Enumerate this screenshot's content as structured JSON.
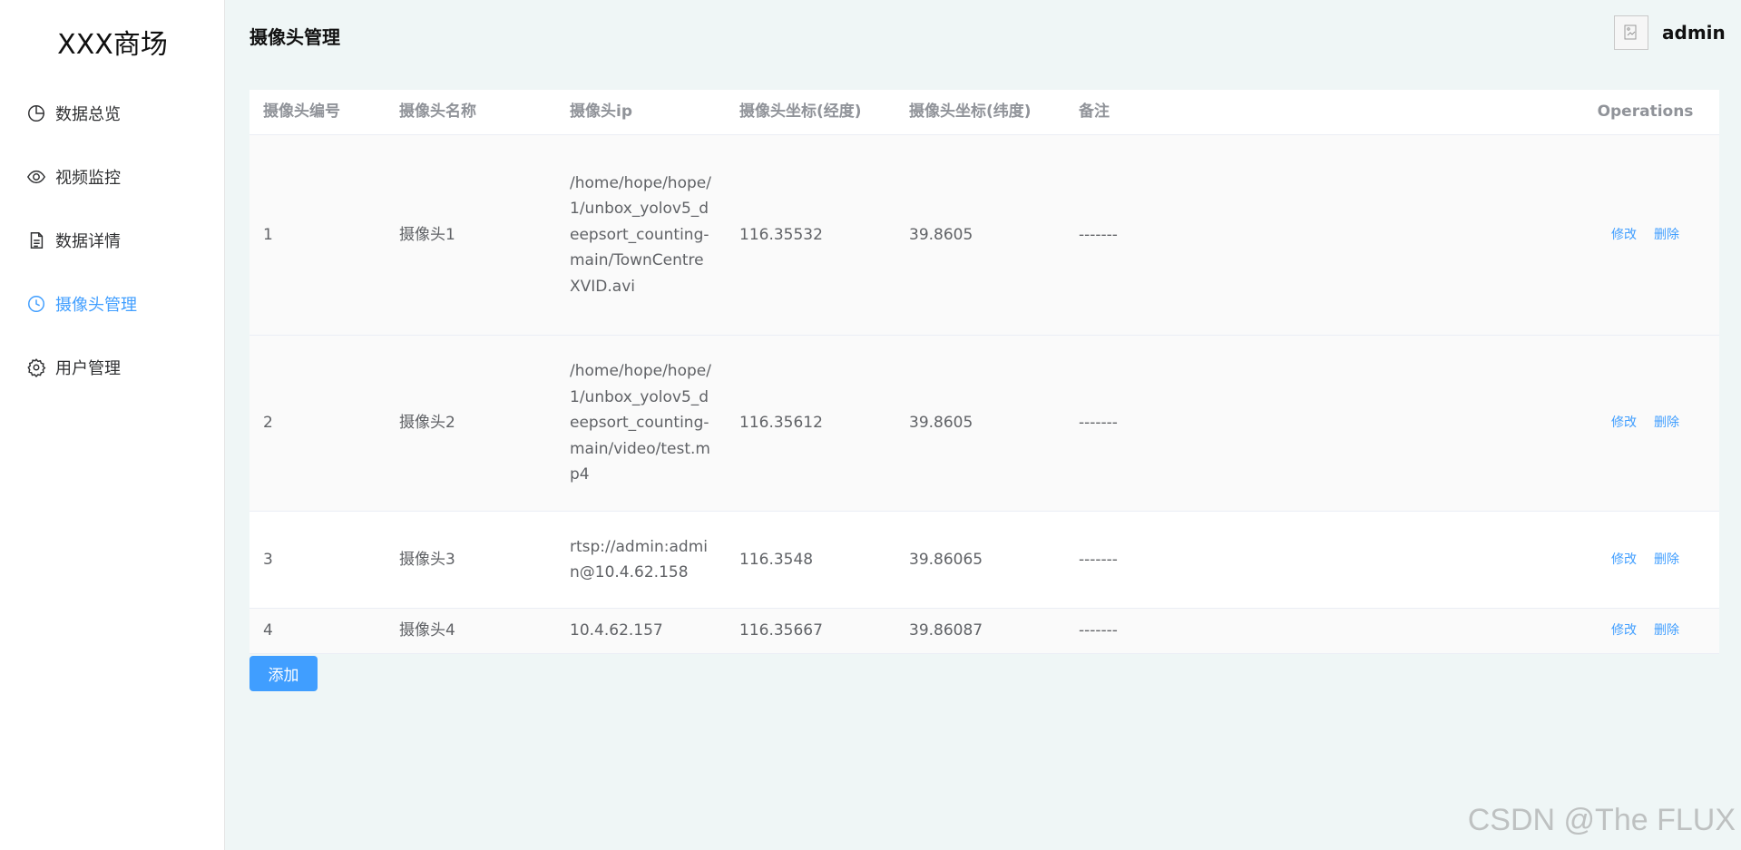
{
  "sidebar": {
    "logo": "XXX商场",
    "items": [
      {
        "label": "数据总览",
        "icon": "pie-chart-icon"
      },
      {
        "label": "视频监控",
        "icon": "eye-icon"
      },
      {
        "label": "数据详情",
        "icon": "document-icon"
      },
      {
        "label": "摄像头管理",
        "icon": "clock-icon",
        "active": true
      },
      {
        "label": "用户管理",
        "icon": "gear-icon"
      }
    ]
  },
  "header": {
    "title": "摄像头管理",
    "username": "admin"
  },
  "table": {
    "columns": [
      "摄像头编号",
      "摄像头名称",
      "摄像头ip",
      "摄像头坐标(经度)",
      "摄像头坐标(纬度)",
      "备注",
      "Operations"
    ],
    "rows": [
      {
        "id": "1",
        "name": "摄像头1",
        "ip": "/home/hope/hope/1/unbox_yolov5_deepsort_counting-main/TownCentreXVID.avi",
        "lng": "116.35532",
        "lat": "39.8605",
        "remark": "-------"
      },
      {
        "id": "2",
        "name": "摄像头2",
        "ip": "/home/hope/hope/1/unbox_yolov5_deepsort_counting-main/video/test.mp4",
        "lng": "116.35612",
        "lat": "39.8605",
        "remark": "-------"
      },
      {
        "id": "3",
        "name": "摄像头3",
        "ip": "rtsp://admin:admin@10.4.62.158",
        "lng": "116.3548",
        "lat": "39.86065",
        "remark": "-------"
      },
      {
        "id": "4",
        "name": "摄像头4",
        "ip": "10.4.62.157",
        "lng": "116.35667",
        "lat": "39.86087",
        "remark": "-------"
      }
    ],
    "edit_label": "修改",
    "delete_label": "删除"
  },
  "add_button": "添加",
  "watermark": "CSDN @The FLUX",
  "colors": {
    "accent": "#409eff",
    "background": "#eff6f6"
  }
}
